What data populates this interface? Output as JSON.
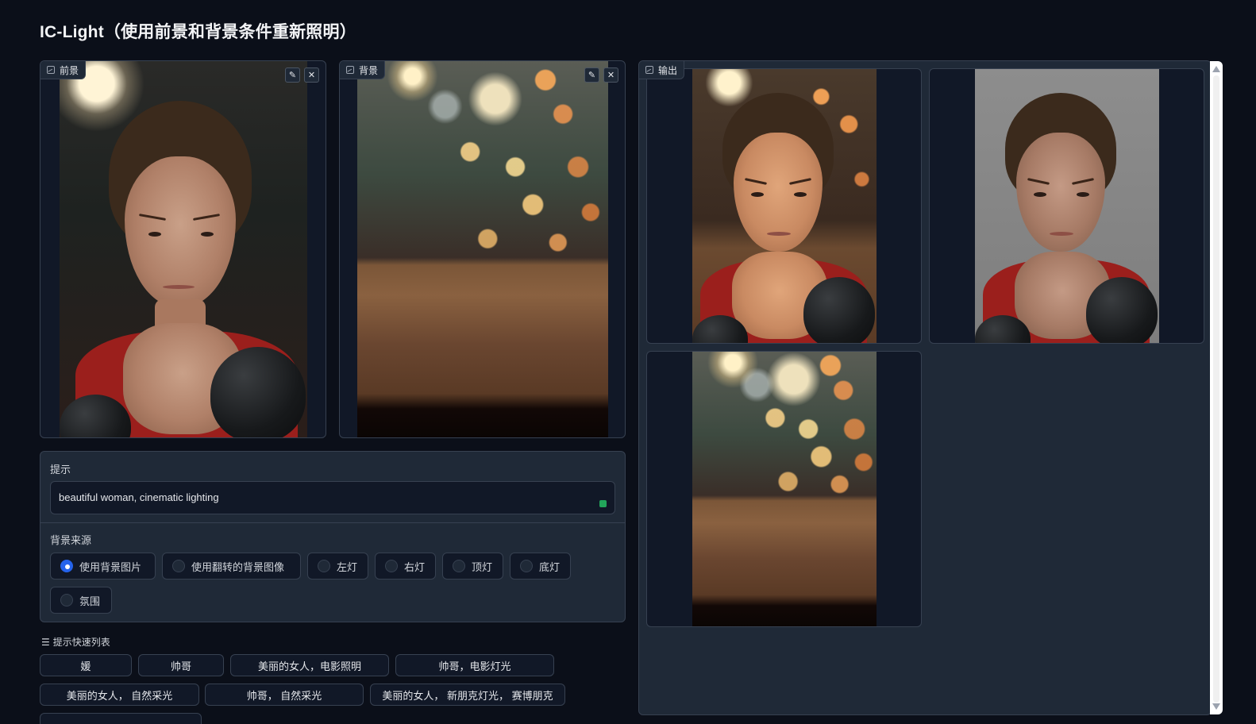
{
  "app": {
    "title": "IC-Light（使用前景和背景条件重新照明）"
  },
  "foreground": {
    "label": "前景",
    "edit_icon": "pencil-icon",
    "clear_icon": "close-icon"
  },
  "background": {
    "label": "背景",
    "edit_icon": "pencil-icon",
    "clear_icon": "close-icon"
  },
  "output": {
    "label": "输出"
  },
  "prompt": {
    "label": "提示",
    "value": "beautiful woman, cinematic lighting"
  },
  "bg_source": {
    "label": "背景来源",
    "options": [
      {
        "label": "使用背景图片",
        "selected": true
      },
      {
        "label": "使用翻转的背景图像",
        "selected": false
      },
      {
        "label": "左灯",
        "selected": false
      },
      {
        "label": "右灯",
        "selected": false
      },
      {
        "label": "顶灯",
        "selected": false
      },
      {
        "label": "底灯",
        "selected": false
      },
      {
        "label": "氛围",
        "selected": false
      }
    ]
  },
  "quick_prompts": {
    "title": "提示快速列表",
    "items": [
      "媛",
      "帅哥",
      "美丽的女人，电影照明",
      "帅哥，电影灯光",
      "美丽的女人， 自然采光",
      "帅哥， 自然采光",
      "美丽的女人， 新朋克灯光， 赛博朋克"
    ]
  },
  "colors": {
    "page_bg": "#0b0f19",
    "panel_bg": "#1f2937",
    "accent": "#2563eb",
    "border": "#374151"
  }
}
